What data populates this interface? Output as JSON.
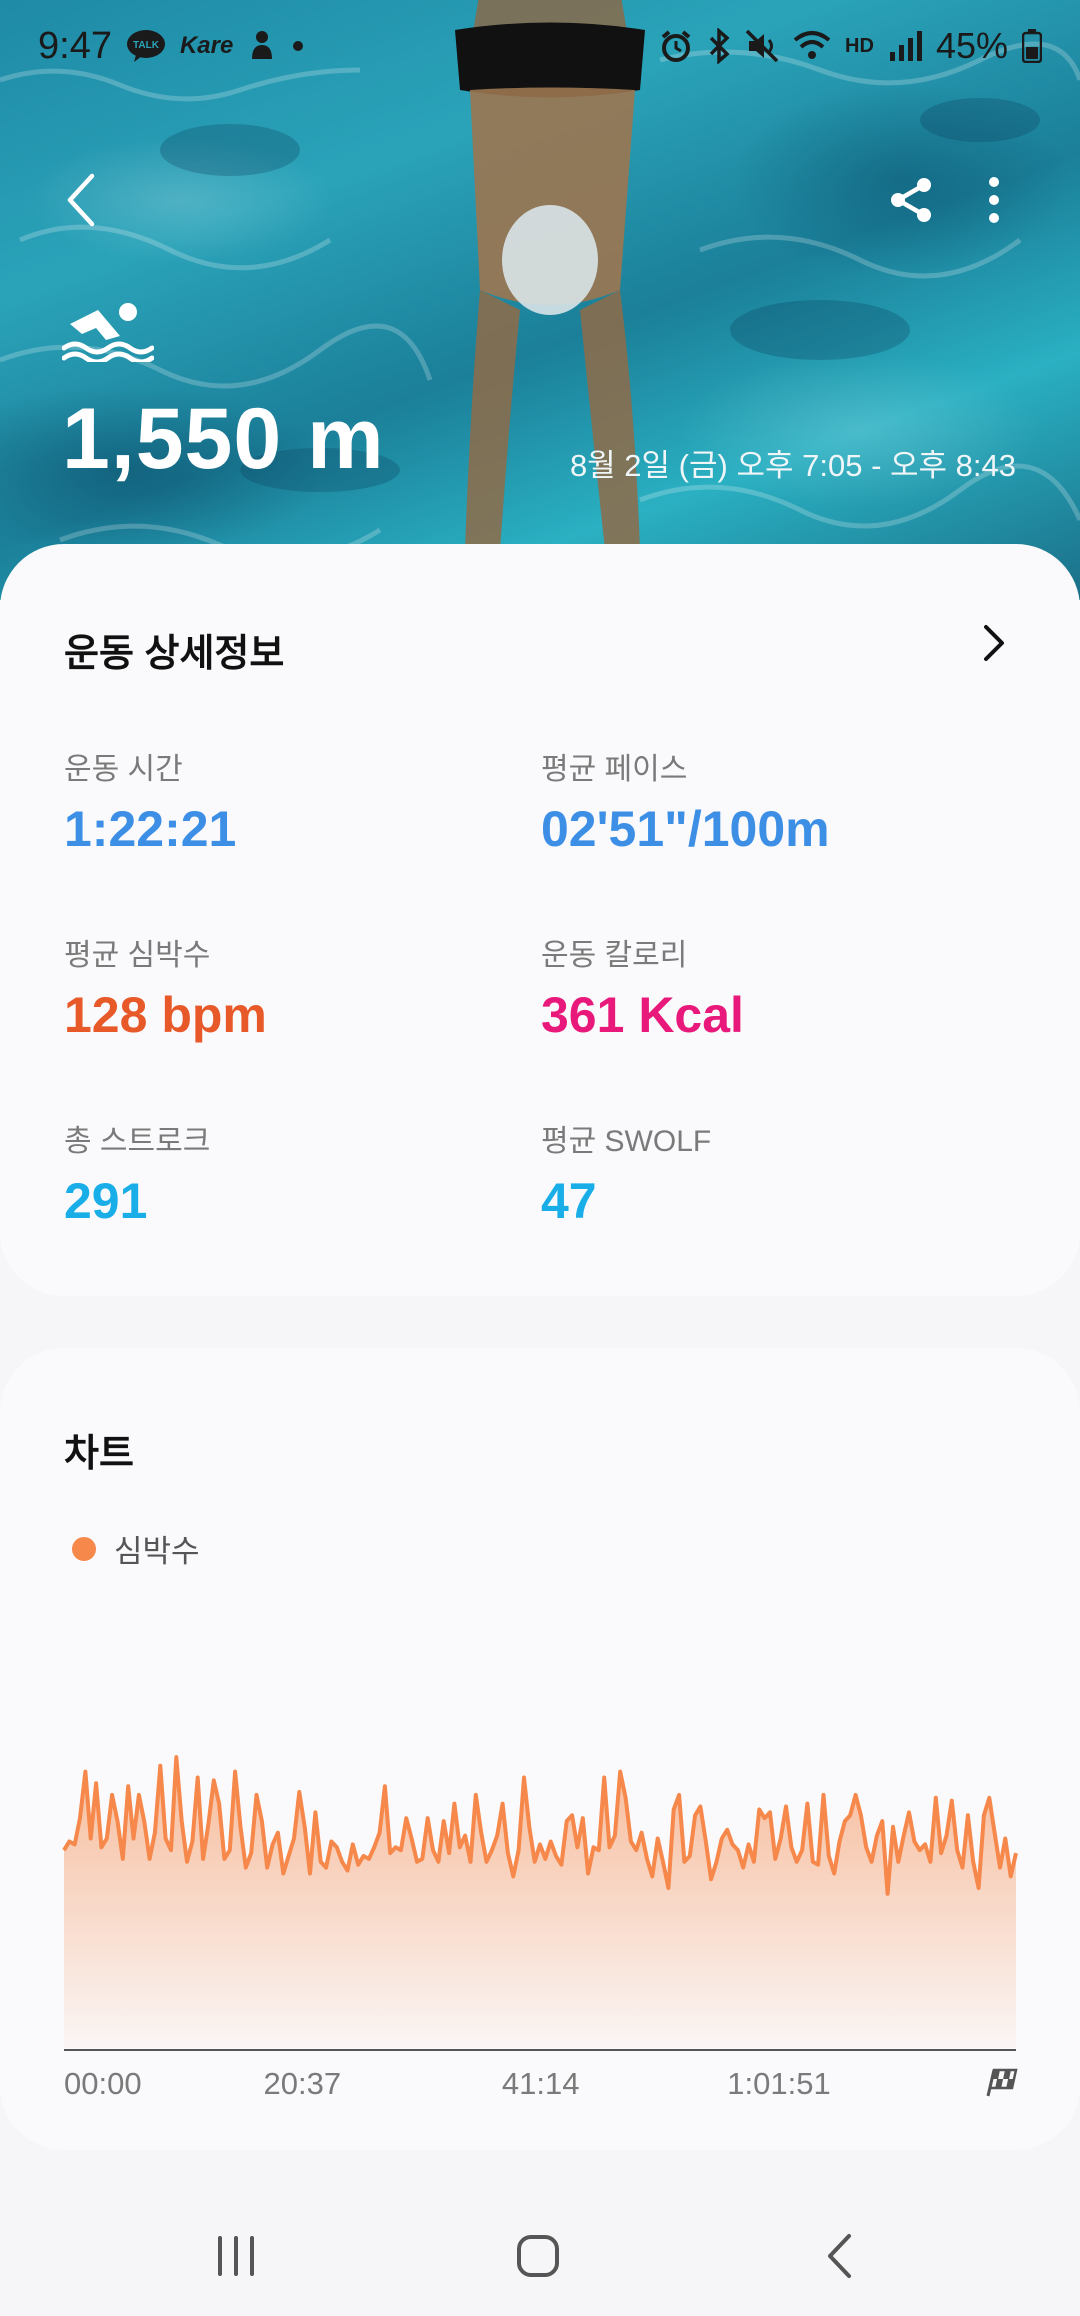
{
  "status_bar": {
    "time": "9:47",
    "battery": "45%",
    "left_icons": [
      "kakaotalk-icon",
      "kare-icon",
      "notification-icon",
      "dot-icon"
    ],
    "right_icons": [
      "alarm-icon",
      "bluetooth-icon",
      "mute-icon",
      "wifi-icon",
      "hd-voice-icon",
      "signal-icon",
      "battery-icon"
    ],
    "kare_text": "Kare",
    "talk_text": "TALK",
    "hd_text": "HD"
  },
  "hero": {
    "distance": "1,550 m",
    "date_range": "8월 2일 (금) 오후 7:05 - 오후 8:43",
    "activity_icon": "swimming-icon"
  },
  "details": {
    "title": "운동 상세정보",
    "metrics": [
      {
        "label": "운동 시간",
        "value": "1:22:21",
        "color": "#3d8fe6"
      },
      {
        "label": "평균 페이스",
        "value": "02'51\"/100m",
        "color": "#3d8fe6"
      },
      {
        "label": "평균 심박수",
        "value": "128 bpm",
        "color": "#e8592a"
      },
      {
        "label": "운동 칼로리",
        "value": "361 Kcal",
        "color": "#e8197a"
      },
      {
        "label": "총 스트로크",
        "value": "291",
        "color": "#1aaee8"
      },
      {
        "label": "평균 SWOLF",
        "value": "47",
        "color": "#1aaee8"
      }
    ]
  },
  "chart_section": {
    "title": "차트",
    "legend_label": "심박수",
    "color": "#f5884a",
    "finish_icon": "checkered-flag-icon"
  },
  "chart_data": {
    "type": "area",
    "series": [
      {
        "name": "심박수"
      }
    ],
    "x_tick_labels": [
      "00:00",
      "20:37",
      "41:14",
      "1:01:51"
    ],
    "x_range_minutes": [
      0,
      82.35
    ],
    "y_range_bpm": [
      60,
      170
    ],
    "values": [
      128,
      131,
      130,
      139,
      155,
      132,
      151,
      129,
      132,
      147,
      138,
      125,
      150,
      132,
      147,
      138,
      125,
      134,
      157,
      132,
      128,
      160,
      138,
      124,
      131,
      153,
      125,
      137,
      152,
      144,
      125,
      128,
      155,
      136,
      122,
      127,
      147,
      138,
      122,
      130,
      134,
      120,
      126,
      132,
      148,
      136,
      120,
      141,
      124,
      122,
      131,
      129,
      124,
      121,
      130,
      123,
      126,
      125,
      129,
      134,
      150,
      127,
      129,
      128,
      139,
      132,
      124,
      125,
      139,
      128,
      124,
      138,
      127,
      144,
      129,
      133,
      124,
      147,
      134,
      124,
      128,
      133,
      144,
      127,
      119,
      128,
      153,
      136,
      124,
      130,
      125,
      131,
      126,
      123,
      138,
      140,
      129,
      139,
      120,
      129,
      128,
      153,
      129,
      133,
      155,
      146,
      131,
      128,
      134,
      125,
      119,
      132,
      124,
      115,
      142,
      147,
      124,
      126,
      140,
      143,
      131,
      118,
      124,
      132,
      135,
      130,
      128,
      122,
      130,
      124,
      142,
      139,
      141,
      125,
      132,
      143,
      129,
      124,
      128,
      144,
      124,
      123,
      147,
      126,
      120,
      131,
      138,
      140,
      147,
      140,
      129,
      124,
      133,
      138,
      113,
      136,
      124,
      133,
      141,
      131,
      128,
      130,
      124,
      146,
      127,
      133,
      145,
      128,
      122,
      140,
      124,
      115,
      140,
      146,
      134,
      122,
      132,
      119,
      127
    ]
  },
  "navbar": {
    "icons": [
      "recents-icon",
      "home-icon",
      "back-icon"
    ]
  }
}
